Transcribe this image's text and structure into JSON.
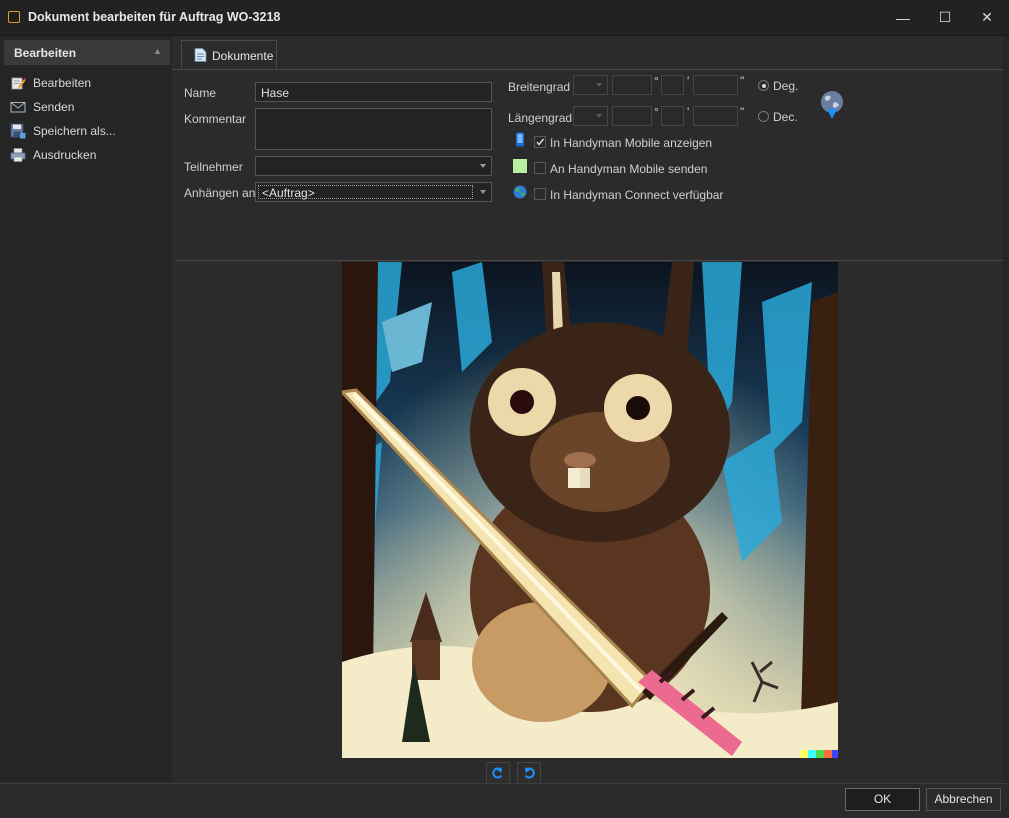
{
  "window": {
    "title": "Dokument bearbeiten für Auftrag WO-3218",
    "minimize_glyph": "—",
    "maximize_glyph": "☐",
    "close_glyph": "✕"
  },
  "sidebar": {
    "header": "Bearbeiten",
    "items": [
      {
        "label": "Bearbeiten",
        "icon": "edit-icon"
      },
      {
        "label": "Senden",
        "icon": "envelope-icon"
      },
      {
        "label": "Speichern als...",
        "icon": "save-icon"
      },
      {
        "label": "Ausdrucken",
        "icon": "printer-icon"
      }
    ]
  },
  "tabs": [
    {
      "label": "Dokumente",
      "icon": "document-icon"
    }
  ],
  "form": {
    "name_label": "Name",
    "name_value": "Hase",
    "comment_label": "Kommentar",
    "comment_value": "",
    "participant_label": "Teilnehmer",
    "participant_value": "",
    "attach_label": "Anhängen an:",
    "attach_value": "<Auftrag>"
  },
  "coordinates": {
    "lat_label": "Breitengrad",
    "lon_label": "Längengrad",
    "degree_symbol": "°",
    "minute_symbol": "'",
    "second_symbol": "\"",
    "deg_option": "Deg.",
    "dec_option": "Dec.",
    "selected_mode": "Deg."
  },
  "options": [
    {
      "label": "In Handyman Mobile anzeigen",
      "checked": true,
      "icon": "mobile-phone-icon"
    },
    {
      "label": "An Handyman Mobile senden",
      "checked": false,
      "icon": "green-square-icon"
    },
    {
      "label": "In Handyman Connect verfügbar",
      "checked": false,
      "icon": "globe-icon"
    }
  ],
  "buttons": {
    "ok": "OK",
    "cancel": "Abbrechen"
  },
  "colors": {
    "accent_blue": "#1e90ff",
    "window_bg": "#2b2b2b",
    "titlebar_bg": "#222222"
  }
}
